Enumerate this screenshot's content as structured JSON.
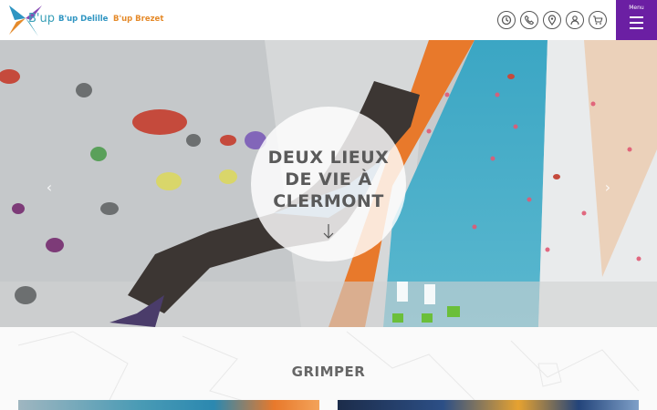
{
  "header": {
    "logo_text": "B'up",
    "sites": [
      {
        "label": "B'up Delille",
        "color": "#2f95c2"
      },
      {
        "label": "B'up Brezet",
        "color": "#e58a2a"
      }
    ],
    "icons": [
      "clock-icon",
      "phone-icon",
      "location-pin-icon",
      "user-icon",
      "cart-icon"
    ],
    "menu_label": "Menu",
    "menu_color": "#6b1fa3"
  },
  "hero": {
    "title_lines": [
      "DEUX LIEUX",
      "DE VIE À",
      "CLERMONT"
    ],
    "prev_arrow": "‹",
    "next_arrow": "›"
  },
  "section": {
    "title": "GRIMPER"
  }
}
